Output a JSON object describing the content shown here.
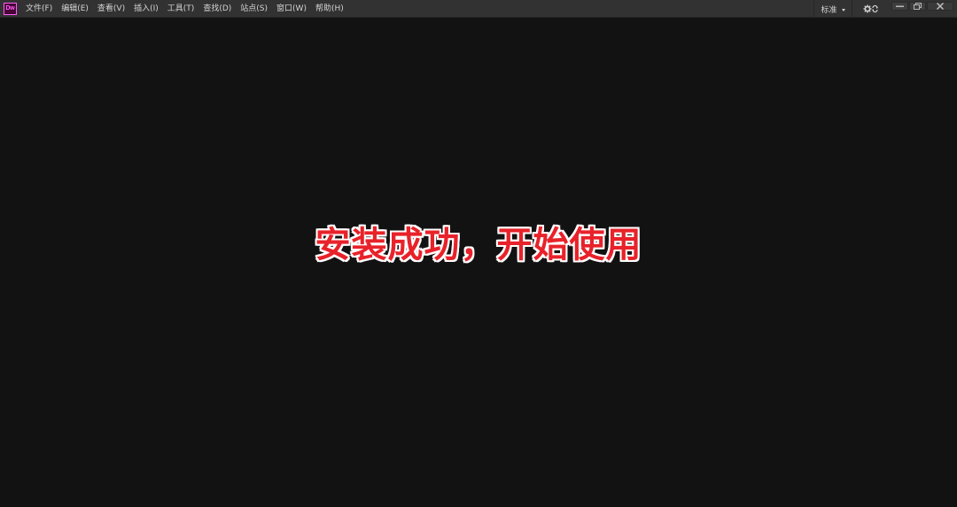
{
  "app": {
    "logo_text": "Dw",
    "logo_color": "#ff61f6",
    "logo_bg": "#470137"
  },
  "menu": {
    "items": [
      {
        "label": "文件(F)"
      },
      {
        "label": "编辑(E)"
      },
      {
        "label": "查看(V)"
      },
      {
        "label": "插入(I)"
      },
      {
        "label": "工具(T)"
      },
      {
        "label": "查找(D)"
      },
      {
        "label": "站点(S)"
      },
      {
        "label": "窗口(W)"
      },
      {
        "label": "帮助(H)"
      }
    ]
  },
  "workspace": {
    "label": "标准",
    "icon": "chevron-down-icon"
  },
  "toolbar": {
    "sync_icon": "gear-sync-icon"
  },
  "window_controls": {
    "minimize_icon": "minimize-icon",
    "maximize_icon": "restore-icon",
    "close_icon": "close-icon"
  },
  "overlay": {
    "message": "安装成功，开始使用",
    "color": "#e8222a"
  }
}
